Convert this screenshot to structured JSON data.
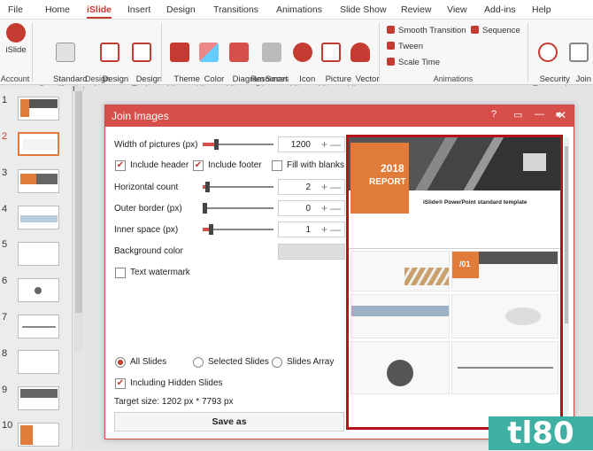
{
  "tabs": [
    "File",
    "Home",
    "iSlide",
    "Insert",
    "Design",
    "Transitions",
    "Animations",
    "Slide Show",
    "Review",
    "View",
    "Add-ins",
    "Help"
  ],
  "ribbon": {
    "account": {
      "label": "iSlide",
      "group": "Account"
    },
    "design_buttons": [
      {
        "label": "Standard\nSpecification ▾"
      },
      {
        "label": "Design\nLayout ▾"
      },
      {
        "label": "Design\nTools"
      }
    ],
    "design_group": "Design",
    "resources_buttons": [
      {
        "label": "Theme\nLibrary"
      },
      {
        "label": "Color\nLibrary"
      },
      {
        "label": "Diagram\nLibrary"
      },
      {
        "label": "Smart\nDiagram"
      },
      {
        "label": "Icon\nLibrary"
      },
      {
        "label": "Picture\nLibrary"
      },
      {
        "label": "Vector\nLibrary"
      }
    ],
    "resources_group": "Resources",
    "animations_items": [
      "Smooth Transition",
      "Tween",
      "Scale Time",
      "Sequence"
    ],
    "animations_group": "Animations",
    "right_buttons": [
      {
        "label": "Security\nExport ▾"
      },
      {
        "label": "Join\nImages"
      }
    ]
  },
  "slide_numbers": [
    "1",
    "2",
    "3",
    "4",
    "5",
    "6",
    "7",
    "8",
    "9",
    "10"
  ],
  "dialog": {
    "title": "Join Images",
    "help": "?",
    "fields": {
      "width_label": "Width of pictures (px)",
      "width_value": "1200",
      "include_header": "Include header",
      "include_footer": "Include footer",
      "fill_blanks": "Fill with blanks",
      "hcount_label": "Horizontal count",
      "hcount_value": "2",
      "outer_label": "Outer border (px)",
      "outer_value": "0",
      "inner_label": "Inner space (px)",
      "inner_value": "1",
      "bg_label": "Background color",
      "text_watermark": "Text watermark",
      "all_slides": "All Slides",
      "selected_slides": "Selected Slides",
      "slides_array": "Slides Array",
      "hidden_slides": "Including Hidden Slides",
      "target_size": "Target size:  1202 px *  7793 px",
      "save_as": "Save as"
    },
    "preview": {
      "year": "2018",
      "report": "REPORT",
      "heading": "iSlide® PowerPoint standard template",
      "section": "/01"
    }
  },
  "watermark": "tl80"
}
